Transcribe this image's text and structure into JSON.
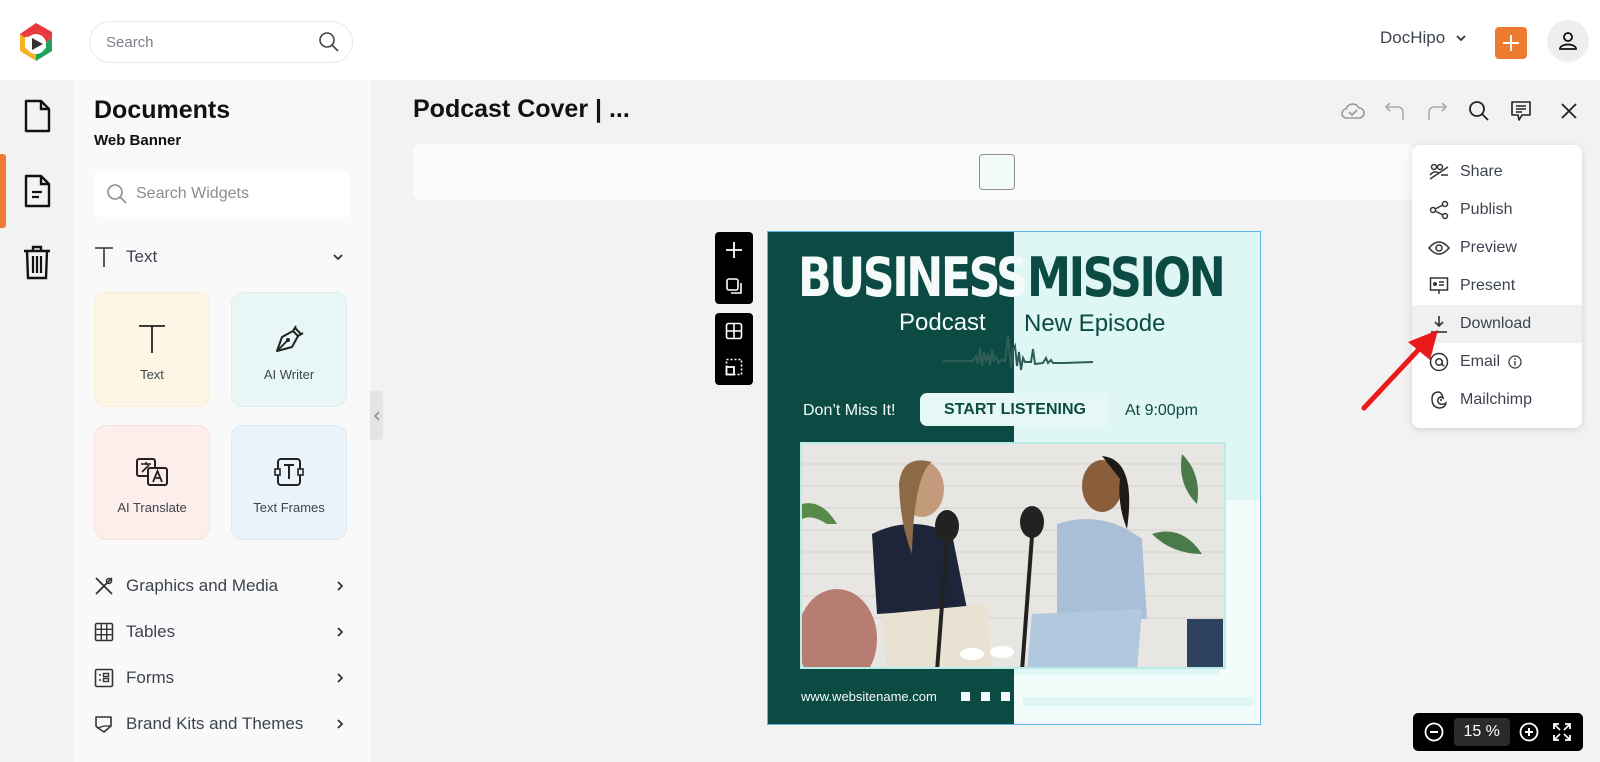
{
  "header": {
    "search_placeholder": "Search",
    "workspace_name": "DocHipo",
    "add_icon": "plus-icon",
    "profile_icon": "user-icon"
  },
  "rail": {
    "items": [
      {
        "name": "documents",
        "icon": "file-icon"
      },
      {
        "name": "my-documents",
        "icon": "file-text-icon",
        "active": true
      },
      {
        "name": "trash",
        "icon": "trash-icon"
      }
    ]
  },
  "panel": {
    "title": "Documents",
    "subtitle": "Web Banner",
    "search_placeholder": "Search Widgets",
    "text_section": {
      "label": "Text",
      "expanded": true
    },
    "tiles": [
      {
        "label": "Text",
        "icon": "text-icon",
        "bg": "#fdf6e5"
      },
      {
        "label": "AI Writer",
        "icon": "pen-nib-icon",
        "bg": "#e8f7f6"
      },
      {
        "label": "AI Translate",
        "icon": "translate-icon",
        "bg": "#fdeeec"
      },
      {
        "label": "Text Frames",
        "icon": "text-frame-icon",
        "bg": "#eaf2fa"
      }
    ],
    "sections": [
      {
        "label": "Graphics and Media",
        "icon": "graphics-icon"
      },
      {
        "label": "Tables",
        "icon": "table-icon"
      },
      {
        "label": "Forms",
        "icon": "form-icon"
      },
      {
        "label": "Brand Kits and Themes",
        "icon": "brand-kit-icon"
      }
    ]
  },
  "editor": {
    "doc_title": "Podcast Cover | ...",
    "toolbar": [
      "cloud-saved-icon",
      "undo-icon",
      "redo-icon",
      "search-icon",
      "comment-icon",
      "close-icon"
    ],
    "background_color": "#f4fcfb",
    "zoom": {
      "value": "15",
      "unit": "%"
    }
  },
  "design": {
    "headline_left": "BUSINESS",
    "headline_right": "MISSION",
    "sub_left": "Podcast",
    "sub_right": "New Episode",
    "dont_miss": "Don’t Miss It!",
    "cta": "START LISTENING",
    "time": "At 9:00pm",
    "url": "www.websitename.com",
    "photo_alt": "Two women talking into podcast microphones",
    "colors": {
      "dark": "#0c4a44",
      "light": "#dff7f4"
    }
  },
  "menu": {
    "items": [
      {
        "label": "Share",
        "icon": "share-people-icon"
      },
      {
        "label": "Publish",
        "icon": "publish-share-icon"
      },
      {
        "label": "Preview",
        "icon": "eye-icon"
      },
      {
        "label": "Present",
        "icon": "present-icon"
      },
      {
        "label": "Download",
        "icon": "download-icon",
        "highlighted": true
      },
      {
        "label": "Email",
        "icon": "at-icon",
        "has_info": true
      },
      {
        "label": "Mailchimp",
        "icon": "mailchimp-icon"
      }
    ]
  },
  "annotation": {
    "arrow_color": "#e81a1a",
    "target": "Download"
  }
}
